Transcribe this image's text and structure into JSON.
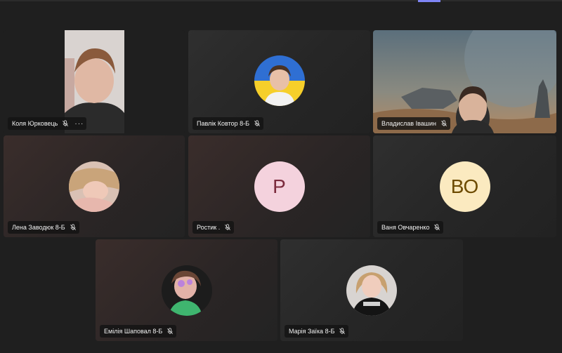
{
  "participants": [
    {
      "name": "Коля Юрковець",
      "avatar": "video-boy"
    },
    {
      "name": "Павлік Ковтор 8-Б",
      "avatar": "photo-boy-ukraine-flag"
    },
    {
      "name": "Владислав Івашин",
      "avatar": "video-scifi-background"
    },
    {
      "name": "Лена Заводюк 8-Б",
      "avatar": "photo-girl"
    },
    {
      "name": "Ростик .",
      "avatar": "initials",
      "initials": "Р",
      "avatar_bg": "#f4d2dd",
      "initials_color": "#7b2b3d"
    },
    {
      "name": "Ваня Овчаренко",
      "avatar": "initials",
      "initials": "ВО",
      "avatar_bg": "#fbeac0",
      "initials_color": "#6d4b00"
    },
    {
      "name": "Емілія Шаповал 8-Б",
      "avatar": "photo-girl-filter"
    },
    {
      "name": "Марія Заїка 8-Б",
      "avatar": "photo-girl-tshirt"
    }
  ],
  "icons": {
    "mic_off": "mic-off-icon",
    "more": "more-options-icon"
  },
  "more_label": "···",
  "colors": {
    "accent": "#7f85f5",
    "stage_bg": "#1f1f1f",
    "tile_bg": "#292929"
  }
}
